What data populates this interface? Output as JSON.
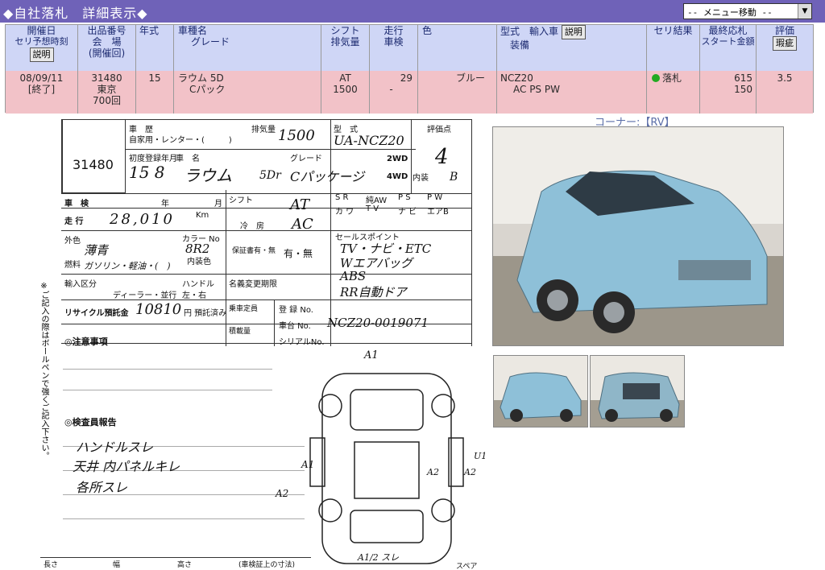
{
  "header": {
    "title": "◆自社落札　詳細表示◆",
    "menu": {
      "selected": "-- メニュー移動 --"
    }
  },
  "table": {
    "headers": {
      "date": [
        "開催日",
        "セリ予想時刻"
      ],
      "date_button": "説明",
      "lot": [
        "出品番号",
        "会　場",
        "(開催回)"
      ],
      "year": "年式",
      "model": [
        "車種名",
        "グレード"
      ],
      "shift": [
        "シフト",
        "排気量"
      ],
      "mileage": [
        "走行",
        "車検"
      ],
      "color": "色",
      "type": [
        "型式　輸入車",
        "装備"
      ],
      "type_button": "説明",
      "result": "セリ結果",
      "price": [
        "最終応札",
        "スタート金額"
      ],
      "rating": "評価",
      "rating_button": "瑕疵"
    },
    "row": {
      "date": "08/09/11",
      "status": "[終了]",
      "lot": "31480",
      "venue": "東京",
      "session": "700回",
      "year": "15",
      "model": "ラウム 5D",
      "grade": "Cパック",
      "shift": "AT",
      "cc": "1500",
      "mileage": "29",
      "shaken": "-",
      "color": "ブルー",
      "type": "NCZ20",
      "equipment": "AC PS PW",
      "result": "落札",
      "final_bid": "615",
      "start_price": "150",
      "rating": "3.5"
    }
  },
  "sheet": {
    "lot_no": "31480",
    "corner_label": "コーナー:【RV】",
    "history_label": "車　歴",
    "history_options": "自家用・レンター・(　　　)",
    "displacement_label": "排気量",
    "displacement": "1500",
    "model_type_label": "型　式",
    "model_type": "UA-NCZ20",
    "grade_label": "評価点",
    "grade_point": "4",
    "interior_label": "内装",
    "interior_grade": "B",
    "reg_label": "初度登録年月",
    "reg_value": "15 8",
    "name_label": "車　名",
    "name_value": "ラウム",
    "doors": "5Dr",
    "grade_name_label": "グレード",
    "grade_name": "Cパッケージ",
    "drive_2wd": "2WD",
    "drive_4wd": "4WD",
    "shaken_label": "車　検",
    "year_label": "年",
    "month_label": "月",
    "shift_label": "シフト",
    "shift_value": "AT",
    "mileage_label": "走 行",
    "mileage_value": "28,010",
    "km_label": "Km",
    "ac_label": "冷　房",
    "ac_value": "AC",
    "options": [
      "S R",
      "純AW",
      "P S",
      "P W",
      "カ ワ",
      "T V",
      "ナ ビ",
      "エアB"
    ],
    "sales_point_label": "セールスポイント",
    "sales_points": [
      "TV・ナビ・ETC",
      "Wエアバッグ",
      "ABS",
      "RR自動ドア"
    ],
    "outer_color_label": "外色",
    "outer_color": "薄青",
    "color_no_label": "カラー No",
    "color_no": "8R2",
    "fuel_label": "燃料",
    "fuel_value": "ガソリン・軽油・(　)",
    "interior_color_label": "内装色",
    "import_label": "輸入区分",
    "handle_label": "ハンドル",
    "dealer": "ディーラー・並行",
    "handle_value": "左・右",
    "recycle_label": "リサイクル預託金",
    "recycle_value": "10810",
    "recycle_suffix": "円 預託済み",
    "caution_label": "◎注意事項",
    "inspector_label": "◎検査員報告",
    "inspector_notes": [
      "ハンドルスレ",
      "天井 内パネルキレ",
      "各所スレ"
    ],
    "chassis_label": "車台 No.",
    "chassis_value": "NCZ20-0019071",
    "reg_no_label": "登 録 No.",
    "serial_label": "シリアルNo.",
    "form_label": "保証書有・無",
    "form_value": "有・無",
    "name_change_label": "名義変更期限",
    "capacity_label": "乗車定員",
    "weight_label": "積載量",
    "footer_labels": [
      "長さ",
      "幅",
      "高さ",
      "(車検証上の寸法)"
    ],
    "diagram_marks": [
      "A1",
      "A1",
      "A2",
      "U1",
      "A2",
      "A2",
      "A1/2 スレ",
      "スペア"
    ],
    "side_note": "※ご記入の際はボールペンで強くご記入下さい。"
  }
}
